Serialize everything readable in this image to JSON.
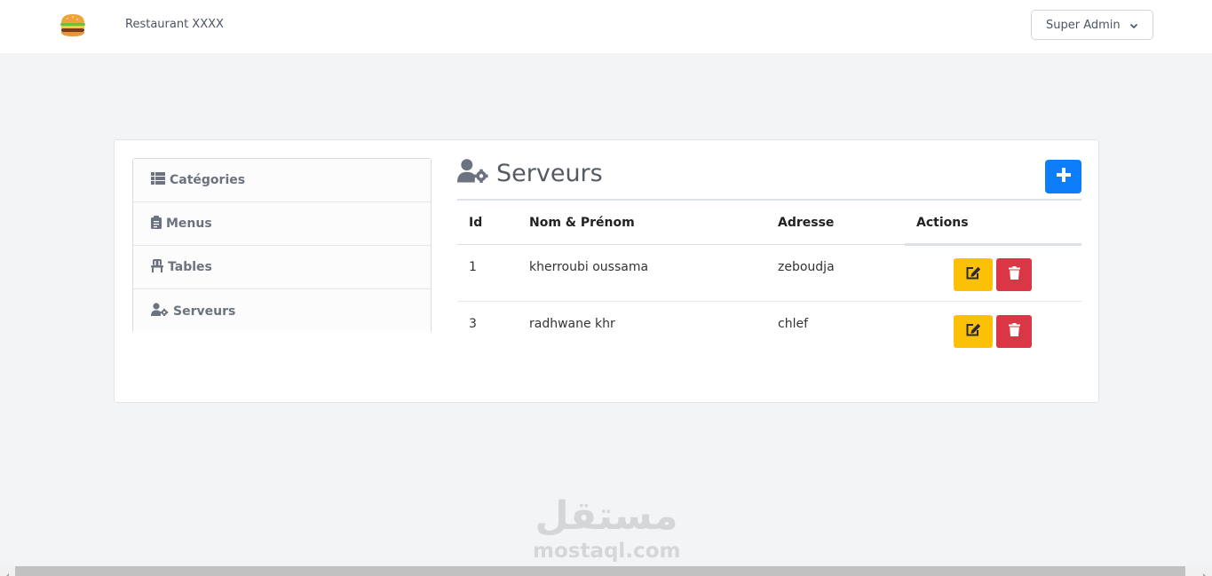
{
  "navbar": {
    "brand": "Restaurant XXXX",
    "logo_icon": "burger-icon",
    "user_menu_label": "Super Admin"
  },
  "sidebar": {
    "items": [
      {
        "label": "Catégories",
        "icon": "th-list-icon"
      },
      {
        "label": "Menus",
        "icon": "clipboard-icon"
      },
      {
        "label": "Tables",
        "icon": "chair-icon"
      },
      {
        "label": "Serveurs",
        "icon": "users-cog-icon"
      }
    ]
  },
  "main": {
    "title": "Serveurs",
    "title_icon": "users-cog-icon",
    "add_button_icon": "plus-icon",
    "table": {
      "headers": [
        "Id",
        "Nom & Prénom",
        "Adresse",
        "Actions"
      ],
      "rows": [
        {
          "id": "1",
          "name": "kherroubi oussama",
          "address": "zeboudja"
        },
        {
          "id": "3",
          "name": "radhwane khr",
          "address": "chlef"
        }
      ]
    }
  },
  "watermark": {
    "arabic": "مستقل",
    "latin": "mostaql.com"
  },
  "colors": {
    "primary": "#0d7dfa",
    "warning": "#fcc106",
    "danger": "#dc3545",
    "background": "#f3f4f6"
  }
}
